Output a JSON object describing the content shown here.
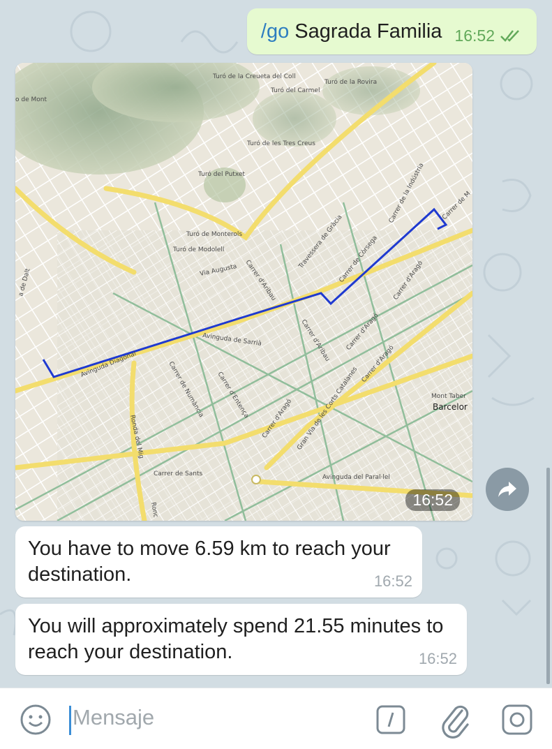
{
  "outgoing": {
    "command": "/go",
    "destination": "Sagrada Familia",
    "time": "16:52",
    "status_icon": "double-check-icon"
  },
  "map": {
    "time": "16:52",
    "labels": {
      "creueta": "Turó de la Creueta del Coll",
      "rovira": "Turó de la Rovira",
      "carmel": "Turó del Carmel",
      "tres_creus": "Turó de les Tres Creus",
      "putxet": "Turó del Putxet",
      "monterols": "Turó de Monterols",
      "modolell": "Turó de Modolell",
      "mont": "o de Mont",
      "via_augusta": "Via Augusta",
      "diagonal": "Avinguda Diagonal",
      "sarria": "Avinguda de Sarrià",
      "travessera": "Travessera de Gràcia",
      "corsega": "Carrer de Còrsega",
      "industria": "Carrer de la Indústria",
      "carrer_m": "Carrer de M",
      "arago1": "Carrer d'Aragó",
      "arago2": "Carrer d'Aragó",
      "arago3": "Carrer d'Aragó",
      "arago4": "Carrer d'Aragó",
      "aribau1": "Carrer d'Aribau",
      "aribau2": "Carrer d'Aribau",
      "numancia": "Carrer de Numància",
      "entenca": "Carrer d'Entença",
      "gran_via": "Gran Via de les Corts Catalanes",
      "sants": "Carrer de Sants",
      "parallel": "Avinguda del Paral·lel",
      "ronda": "Ronda del Mig",
      "ronda2": "Ronc",
      "dalt": "a de Dalt",
      "mont_taber": "Mont Taber",
      "barcelona": "Barcelor"
    }
  },
  "messages": [
    {
      "text": "You have to move 6.59 km to reach your destination.",
      "time": "16:52"
    },
    {
      "text": "You will approximately spend 21.55 minutes to reach your destination.",
      "time": "16:52"
    }
  ],
  "input": {
    "placeholder": "Mensaje"
  },
  "colors": {
    "background": "#d2dde3",
    "outgoing_bubble": "#e6fad0",
    "incoming_bubble": "#ffffff",
    "command_link": "#2d7dc0",
    "outgoing_time": "#62a95a",
    "route": "#1f3ad0"
  }
}
